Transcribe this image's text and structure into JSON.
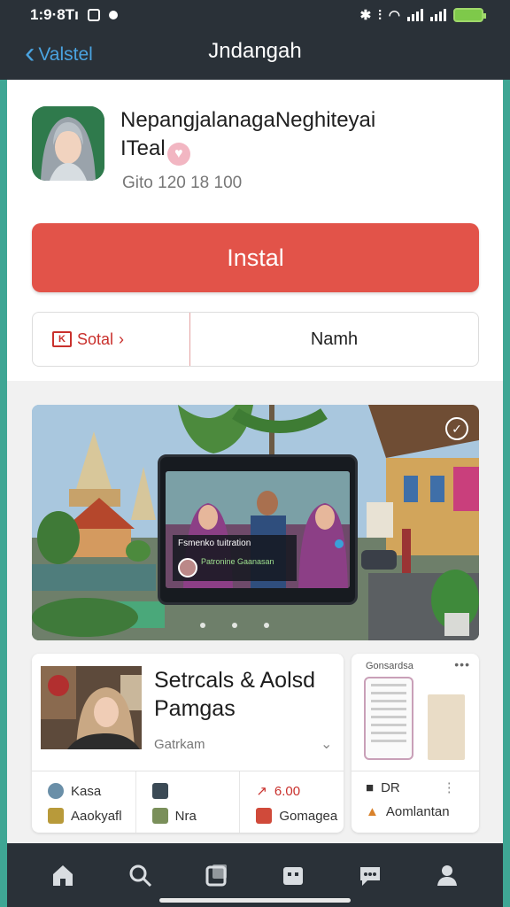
{
  "status_bar": {
    "time": "1:9·8Tı",
    "icons": [
      "photo-icon",
      "notification-dot-icon",
      "bluetooth-icon",
      "vibrate-icon",
      "wifi-icon",
      "signal-icon",
      "signal-icon",
      "battery-charging-icon"
    ]
  },
  "nav": {
    "back_label": "Valstel",
    "title": "Jndangah"
  },
  "app": {
    "name": "NepangjalanagaNeghiteyai",
    "name_line2": "ITeal",
    "meta": "Gito 120 18 100",
    "install_label": "Instal",
    "secondary_left_label": "Sotal",
    "secondary_left_icon_text": "K",
    "secondary_right_label": "Namh"
  },
  "banner": {
    "caption_line1": "Fsmenko tuitration",
    "caption_line2": "Patronine Gaanasan"
  },
  "card_main": {
    "title": "Setrcals & Aolsd Pamgas",
    "subtitle": "Gatrkam",
    "stats": [
      {
        "top": "Kasa",
        "bottom": "Aaokyafl"
      },
      {
        "top": "",
        "bottom": "Nra"
      },
      {
        "top": "6.00",
        "bottom": "Gomagea"
      }
    ]
  },
  "card_side": {
    "label": "Gonsardsa",
    "top": "DR",
    "bottom": "Aomlantan"
  },
  "colors": {
    "accent_red": "#e25349",
    "dark_bar": "#2a3138",
    "link_blue": "#4aa3e0",
    "frame_teal": "#3fa694"
  }
}
